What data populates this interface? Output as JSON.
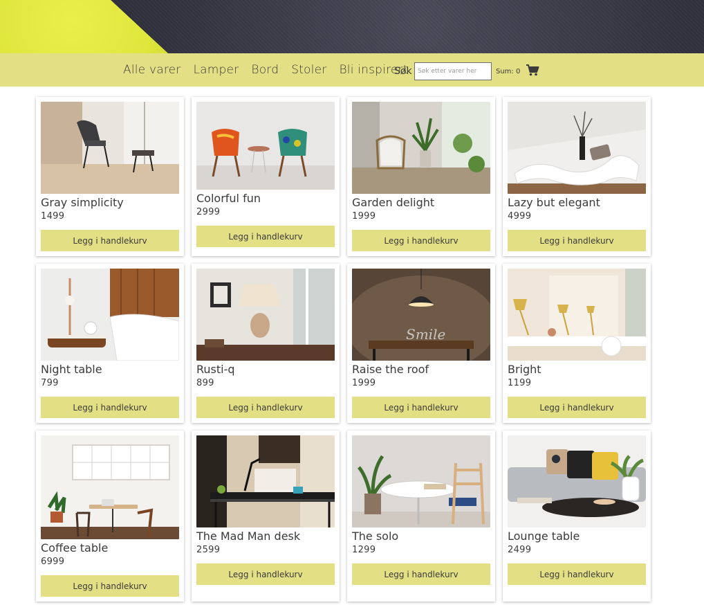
{
  "nav": {
    "links": [
      "Alle varer",
      "Lamper",
      "Bord",
      "Stoler",
      "Bli inspirert"
    ],
    "search_label": "Søk",
    "search_placeholder": "Søk etter varer her",
    "sum_text": "Sum: 0",
    "cart_icon": "shopping-cart-icon"
  },
  "colors": {
    "accent": "#e3df84",
    "hero_dark": "#32323f",
    "hero_yellow": "#dfe63c"
  },
  "button_label": "Legg i handlekurv",
  "products": [
    {
      "title": "Gray simplicity",
      "price": "1499",
      "image": "gray-armchair-photo"
    },
    {
      "title": "Colorful fun",
      "price": "2999",
      "image": "colorful-chairs-photo"
    },
    {
      "title": "Garden delight",
      "price": "1999",
      "image": "balcony-chair-photo"
    },
    {
      "title": "Lazy but elegant",
      "price": "4999",
      "image": "white-lounger-photo"
    },
    {
      "title": "Night table",
      "price": "799",
      "image": "night-table-photo"
    },
    {
      "title": "Rusti-q",
      "price": "899",
      "image": "table-lamp-photo"
    },
    {
      "title": "Raise the roof",
      "price": "1999",
      "image": "pendant-lamp-photo"
    },
    {
      "title": "Bright",
      "price": "1199",
      "image": "brass-lamps-photo"
    },
    {
      "title": "Coffee table",
      "price": "6999",
      "image": "coffee-table-photo"
    },
    {
      "title": "The Mad Man desk",
      "price": "2599",
      "image": "glass-desk-photo"
    },
    {
      "title": "The solo",
      "price": "1299",
      "image": "round-table-photo"
    },
    {
      "title": "Lounge table",
      "price": "2499",
      "image": "lounge-table-photo"
    }
  ]
}
